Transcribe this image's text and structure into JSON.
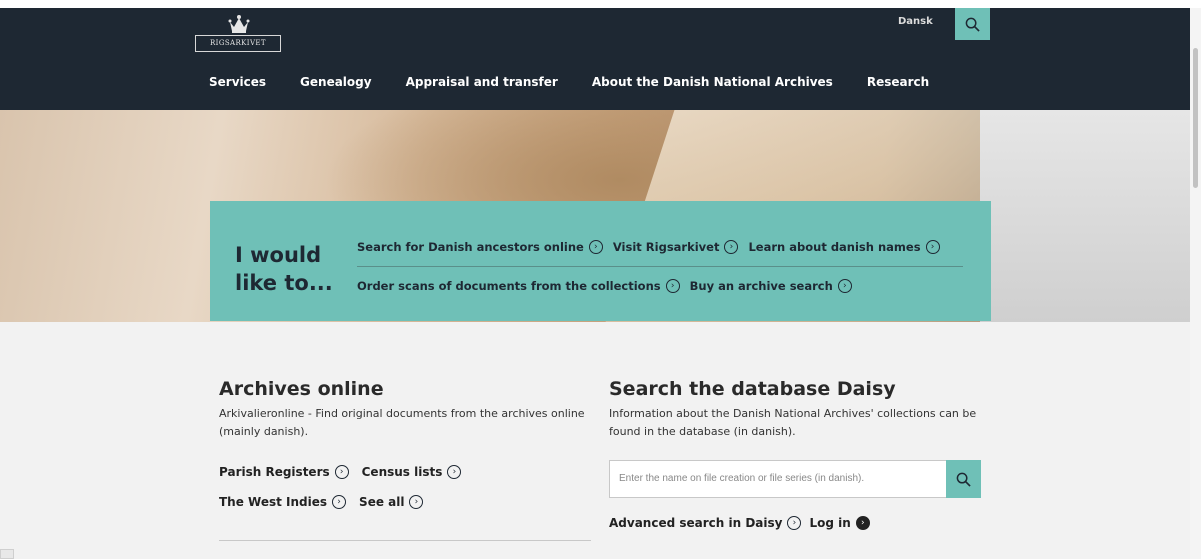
{
  "header": {
    "logo_text": "RIGSARKIVET",
    "language_label": "Dansk",
    "search_icon": "search-icon",
    "nav": [
      {
        "label": "Services"
      },
      {
        "label": "Genealogy"
      },
      {
        "label": "Appraisal and transfer"
      },
      {
        "label": "About the Danish National Archives"
      },
      {
        "label": "Research"
      }
    ]
  },
  "hero": {
    "title": "I would like to...",
    "row1": [
      {
        "label": "Search for Danish ancestors online"
      },
      {
        "label": "Visit Rigsarkivet"
      },
      {
        "label": "Learn about danish names"
      }
    ],
    "row2": [
      {
        "label": "Order scans of documents from the collections"
      },
      {
        "label": "Buy an archive search"
      }
    ],
    "link_icon": "circle-chevron-right-icon"
  },
  "archives_online": {
    "title": "Archives online",
    "description": "Arkivalieronline - Find original documents from the archives online (mainly danish).",
    "links": [
      {
        "label": "Parish Registers"
      },
      {
        "label": "Census lists"
      },
      {
        "label": "The West Indies"
      },
      {
        "label": "See all"
      }
    ]
  },
  "daisy": {
    "title": "Search the database Daisy",
    "description": "Information about the Danish National Archives' collections can be found in the database (in danish).",
    "search_placeholder": "Enter the name on file creation or file series (in danish).",
    "advanced_label": "Advanced search in Daisy",
    "login_label": "Log in"
  },
  "colors": {
    "header_bg": "#1e2833",
    "accent_teal": "#6fc0b7",
    "page_bg": "#f2f2f2"
  }
}
